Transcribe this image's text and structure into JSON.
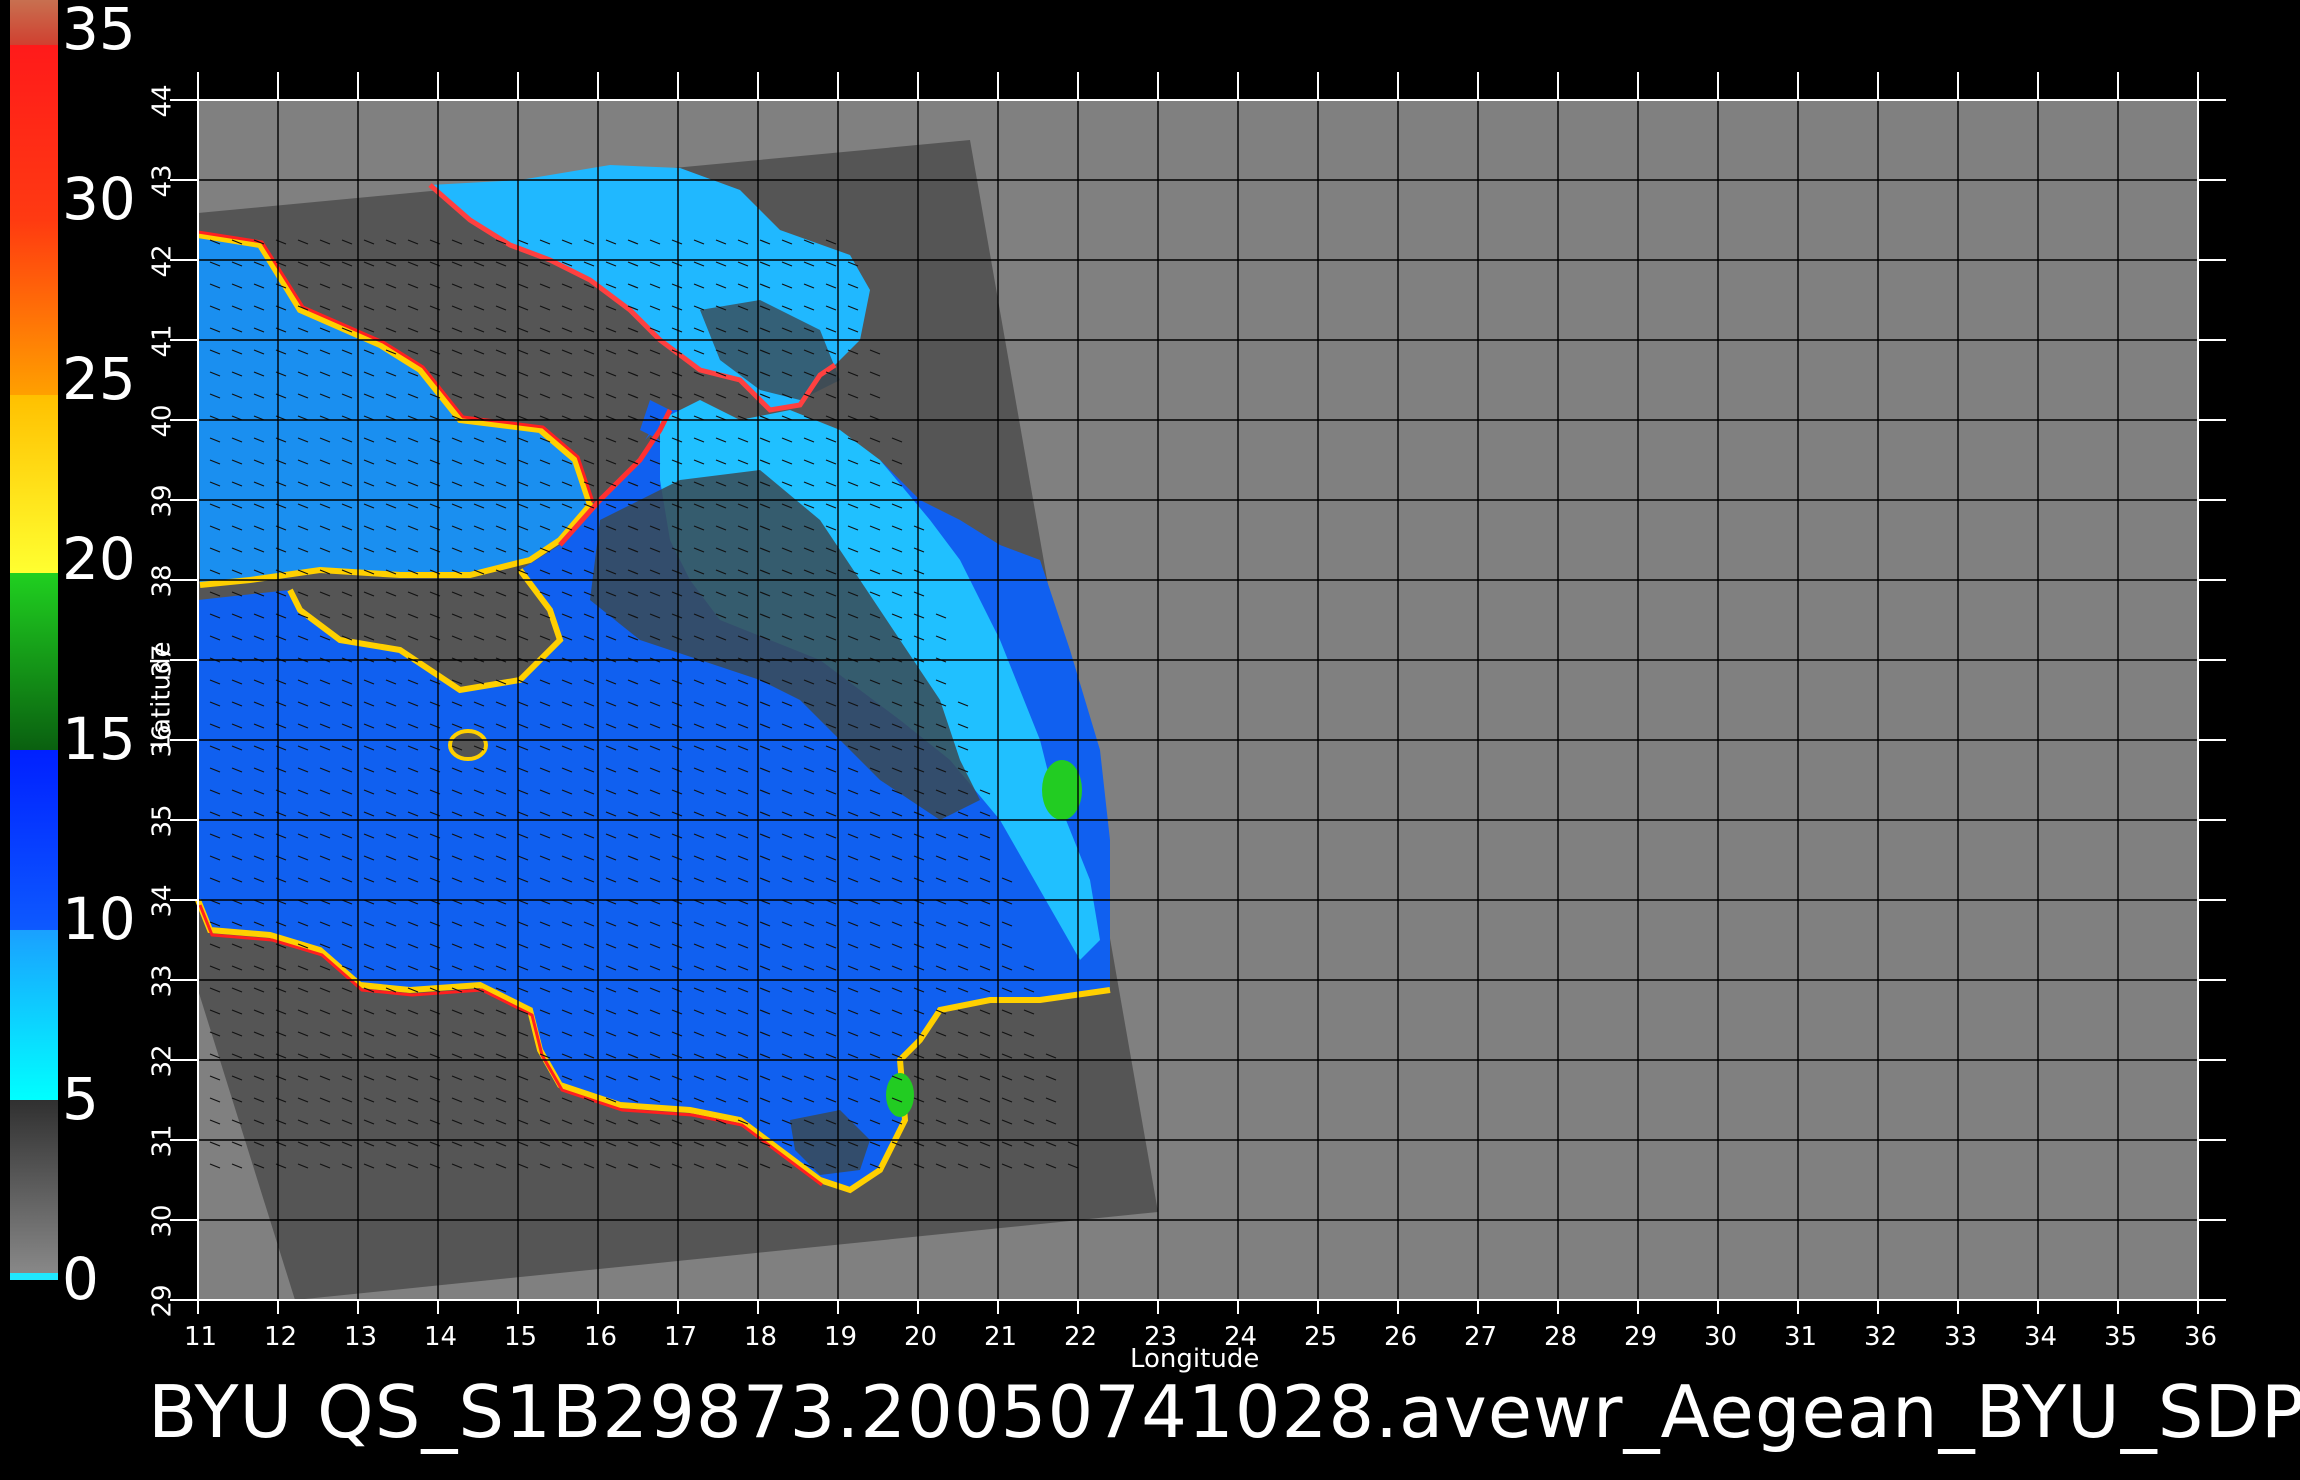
{
  "title": "BYU  QS_S1B29873.20050741028.avewr_Aegean_BYU_SDP",
  "colorbar": {
    "ticks": [
      "35",
      "30",
      "25",
      "20",
      "15",
      "10",
      "5",
      "0"
    ],
    "stops": [
      {
        "from": 0,
        "to": 1.5,
        "color": "#c87050"
      },
      {
        "from": 1.5,
        "to": 5.5,
        "color": "#ff1a1a"
      },
      {
        "from": 5.5,
        "to": 10.5,
        "color": "#ff5a10"
      },
      {
        "from": 10.5,
        "to": 15.5,
        "color": "#ffd000"
      },
      {
        "from": 15.5,
        "to": 20.5,
        "color": "#22cc22"
      },
      {
        "from": 20.5,
        "to": 25.5,
        "color": "#1050ff"
      },
      {
        "from": 25.5,
        "to": 30.5,
        "color": "#20e8ff"
      },
      {
        "from": 30.5,
        "to": 35.5,
        "color": "#555555"
      }
    ]
  },
  "axes": {
    "xlabel": "Longitude",
    "ylabel": "Latitude",
    "lon_ticks": [
      "11",
      "12",
      "13",
      "14",
      "15",
      "16",
      "17",
      "18",
      "19",
      "20",
      "21",
      "22",
      "23",
      "24",
      "25",
      "26",
      "27",
      "28",
      "29",
      "30",
      "31",
      "32",
      "33",
      "34",
      "35",
      "36"
    ],
    "lat_ticks": [
      "44",
      "43",
      "42",
      "41",
      "40",
      "39",
      "38",
      "37",
      "36",
      "35",
      "34",
      "33",
      "32",
      "31",
      "30",
      "29"
    ]
  },
  "colors": {
    "background": "#000000",
    "no_data": "#808080",
    "swath_land": "#555555",
    "grid": "#000000"
  }
}
